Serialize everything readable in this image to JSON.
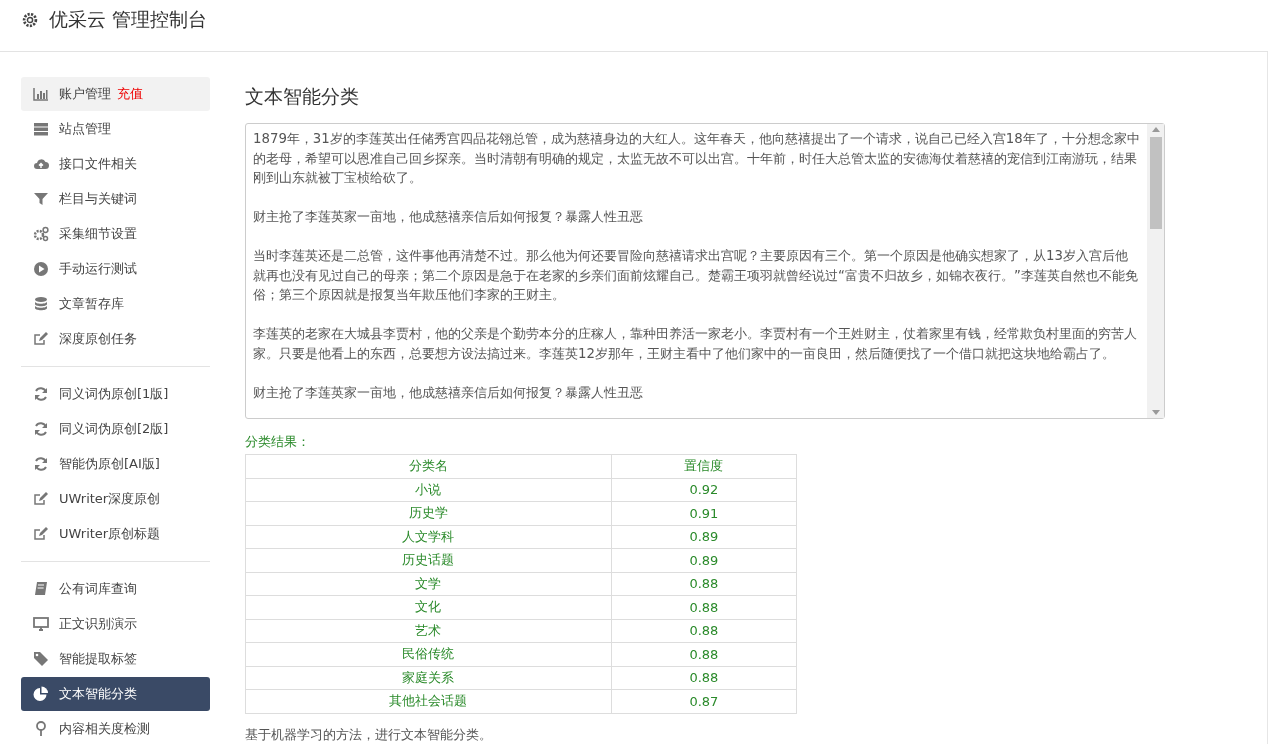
{
  "header": {
    "title": "优采云 管理控制台"
  },
  "sidebar": {
    "groups": [
      {
        "items": [
          {
            "kind": "chart",
            "label": "账户管理",
            "badge": "充值",
            "highlighted": true,
            "selected": false
          },
          {
            "kind": "server",
            "label": "站点管理",
            "highlighted": false,
            "selected": false
          },
          {
            "kind": "cloud",
            "label": "接口文件相关",
            "highlighted": false,
            "selected": false
          },
          {
            "kind": "filter",
            "label": "栏目与关键词",
            "highlighted": false,
            "selected": false
          },
          {
            "kind": "gears",
            "label": "采集细节设置",
            "highlighted": false,
            "selected": false
          },
          {
            "kind": "play",
            "label": "手动运行测试",
            "highlighted": false,
            "selected": false
          },
          {
            "kind": "database",
            "label": "文章暂存库",
            "highlighted": false,
            "selected": false
          },
          {
            "kind": "edit",
            "label": "深度原创任务",
            "highlighted": false,
            "selected": false
          }
        ]
      },
      {
        "items": [
          {
            "kind": "refresh",
            "label": "同义词伪原创[1版]",
            "highlighted": false,
            "selected": false
          },
          {
            "kind": "refresh",
            "label": "同义词伪原创[2版]",
            "highlighted": false,
            "selected": false
          },
          {
            "kind": "refresh",
            "label": "智能伪原创[AI版]",
            "highlighted": false,
            "selected": false
          },
          {
            "kind": "edit",
            "label": "UWriter深度原创",
            "highlighted": false,
            "selected": false
          },
          {
            "kind": "edit",
            "label": "UWriter原创标题",
            "highlighted": false,
            "selected": false
          }
        ]
      },
      {
        "items": [
          {
            "kind": "book",
            "label": "公有词库查询",
            "highlighted": false,
            "selected": false
          },
          {
            "kind": "monitor",
            "label": "正文识别演示",
            "highlighted": false,
            "selected": false
          },
          {
            "kind": "tag",
            "label": "智能提取标签",
            "highlighted": false,
            "selected": false
          },
          {
            "kind": "pie",
            "label": "文本智能分类",
            "highlighted": false,
            "selected": true
          },
          {
            "kind": "pin",
            "label": "内容相关度检测",
            "highlighted": false,
            "selected": false
          }
        ]
      }
    ]
  },
  "main": {
    "title": "文本智能分类",
    "text_input": {
      "paragraphs": [
        "1879年，31岁的李莲英出任储秀宫四品花翎总管，成为慈禧身边的大红人。这年春天，他向慈禧提出了一个请求，说自己已经入宫18年了，十分想念家中的老母，希望可以恩准自己回乡探亲。当时清朝有明确的规定，太监无故不可以出宫。十年前，时任大总管太监的安德海仗着慈禧的宠信到江南游玩，结果刚到山东就被丁宝桢给砍了。",
        "财主抢了李莲英家一亩地，他成慈禧亲信后如何报复？暴露人性丑恶",
        "当时李莲英还是二总管，这件事他再清楚不过。那么他为何还要冒险向慈禧请求出宫呢？主要原因有三个。第一个原因是他确实想家了，从13岁入宫后他就再也没有见过自己的母亲；第二个原因是急于在老家的乡亲们面前炫耀自己。楚霸王项羽就曾经说过“富贵不归故乡，如锦衣夜行。”李莲英自然也不能免俗；第三个原因就是报复当年欺压他们李家的王财主。",
        "李莲英的老家在大城县李贾村，他的父亲是个勤劳本分的庄稼人，靠种田养活一家老小。李贾村有一个王姓财主，仗着家里有钱，经常欺负村里面的穷苦人家。只要是他看上的东西，总要想方设法搞过来。李莲英12岁那年，王财主看中了他们家中的一亩良田，然后随便找了一个借口就把这块地给霸占了。",
        "财主抢了李莲英家一亩地，他成慈禧亲信后如何报复？暴露人性丑恶"
      ]
    },
    "result_label": "分类结果：",
    "table": {
      "columns": [
        "分类名",
        "置信度"
      ],
      "rows": [
        [
          "小说",
          "0.92"
        ],
        [
          "历史学",
          "0.91"
        ],
        [
          "人文学科",
          "0.89"
        ],
        [
          "历史话题",
          "0.89"
        ],
        [
          "文学",
          "0.88"
        ],
        [
          "文化",
          "0.88"
        ],
        [
          "艺术",
          "0.88"
        ],
        [
          "民俗传统",
          "0.88"
        ],
        [
          "家庭关系",
          "0.88"
        ],
        [
          "其他社会话题",
          "0.87"
        ]
      ]
    },
    "note": "基于机器学习的方法，进行文本智能分类。"
  }
}
